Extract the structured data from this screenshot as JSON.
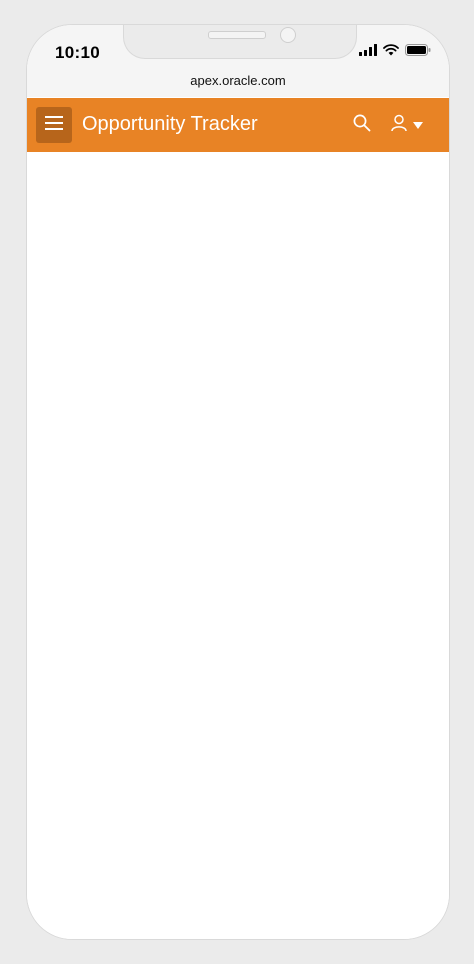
{
  "status_bar": {
    "time": "10:10",
    "icons": [
      "cellular-signal-icon",
      "wifi-icon",
      "battery-icon"
    ]
  },
  "browser": {
    "url": "apex.oracle.com"
  },
  "header": {
    "title": "Opportunity Tracker",
    "background_color": "#e88325",
    "menu_button_color": "#b7651b",
    "icons": [
      "hamburger-menu-icon",
      "search-icon",
      "user-icon",
      "caret-down-icon"
    ]
  },
  "content": {}
}
